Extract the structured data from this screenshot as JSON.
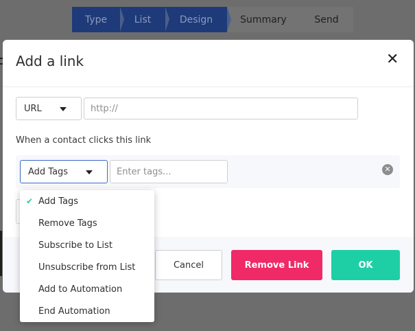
{
  "stepper": {
    "steps": [
      {
        "label": "Type",
        "state": "done"
      },
      {
        "label": "List",
        "state": "done"
      },
      {
        "label": "Design",
        "state": "done"
      },
      {
        "label": "Summary",
        "state": "todo"
      },
      {
        "label": "Send",
        "state": "todo"
      }
    ]
  },
  "modal": {
    "title": "Add a link",
    "close_icon": "close-icon",
    "link_type": {
      "selected": "URL"
    },
    "url_input": {
      "placeholder": "http://",
      "value": ""
    },
    "section_label": "When a contact clicks this link",
    "action": {
      "selected": "Add Tags",
      "tags_input": {
        "placeholder": "Enter tags...",
        "value": ""
      },
      "clear_icon": "clear-circle-icon"
    },
    "footer": {
      "cancel_label": "Cancel",
      "remove_label": "Remove Link",
      "ok_label": "OK"
    }
  },
  "dropdown": {
    "check_icon": "checkmark-icon",
    "options": [
      {
        "label": "Add Tags",
        "selected": true
      },
      {
        "label": "Remove Tags",
        "selected": false
      },
      {
        "label": "Subscribe to List",
        "selected": false
      },
      {
        "label": "Unsubscribe from List",
        "selected": false
      },
      {
        "label": "Add to Automation",
        "selected": false
      },
      {
        "label": "End Automation",
        "selected": false
      }
    ]
  },
  "colors": {
    "accent_blue": "#3a69c7",
    "remove_pink": "#ef2a67",
    "ok_teal": "#1ecfa6",
    "stepper_done": "#1e3a78"
  }
}
